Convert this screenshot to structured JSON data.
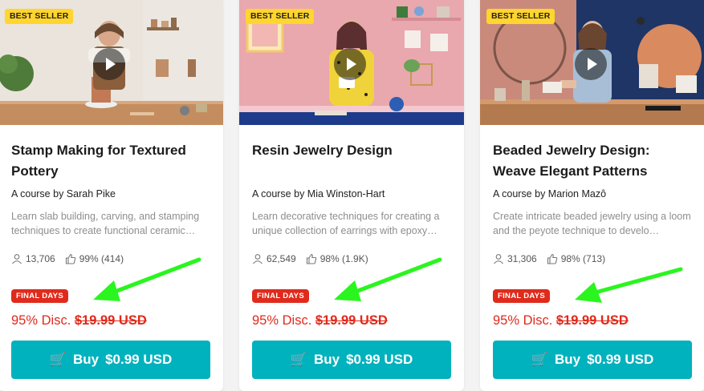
{
  "courses": [
    {
      "badge": "BEST SELLER",
      "title": "Stamp Making for Textured Pottery",
      "author": "A course by Sarah Pike",
      "description": "Learn slab building, carving, and stamping techniques to create functional ceramic…",
      "students": "13,706",
      "rating": "99% (414)",
      "final_label": "FINAL DAYS",
      "discount": "95% Disc.",
      "old_price": "$19.99 USD",
      "buy_label": "Buy",
      "buy_price": "$0.99 USD"
    },
    {
      "badge": "BEST SELLER",
      "title": "Resin Jewelry Design",
      "author": "A course by Mia Winston-Hart",
      "description": "Learn decorative techniques for creating a unique collection of earrings with epoxy…",
      "students": "62,549",
      "rating": "98% (1.9K)",
      "final_label": "FINAL DAYS",
      "discount": "95% Disc.",
      "old_price": "$19.99 USD",
      "buy_label": "Buy",
      "buy_price": "$0.99 USD"
    },
    {
      "badge": "BEST SELLER",
      "title": "Beaded Jewelry Design: Weave Elegant Patterns",
      "author": "A course by Marion Mazô",
      "description": "Create intricate beaded jewelry using a loom and the peyote technique to develo…",
      "students": "31,306",
      "rating": "98% (713)",
      "final_label": "FINAL DAYS",
      "discount": "95% Disc.",
      "old_price": "$19.99 USD",
      "buy_label": "Buy",
      "buy_price": "$0.99 USD"
    }
  ],
  "colors": {
    "accent": "#00b2bd",
    "sale_red": "#e02a1b",
    "badge_yellow": "#ffd52e",
    "annotation_arrow": "#2bf51f"
  },
  "icons": {
    "students": "user-icon",
    "rating": "thumbs-up-icon",
    "buy": "cart-icon",
    "video": "play-icon"
  }
}
